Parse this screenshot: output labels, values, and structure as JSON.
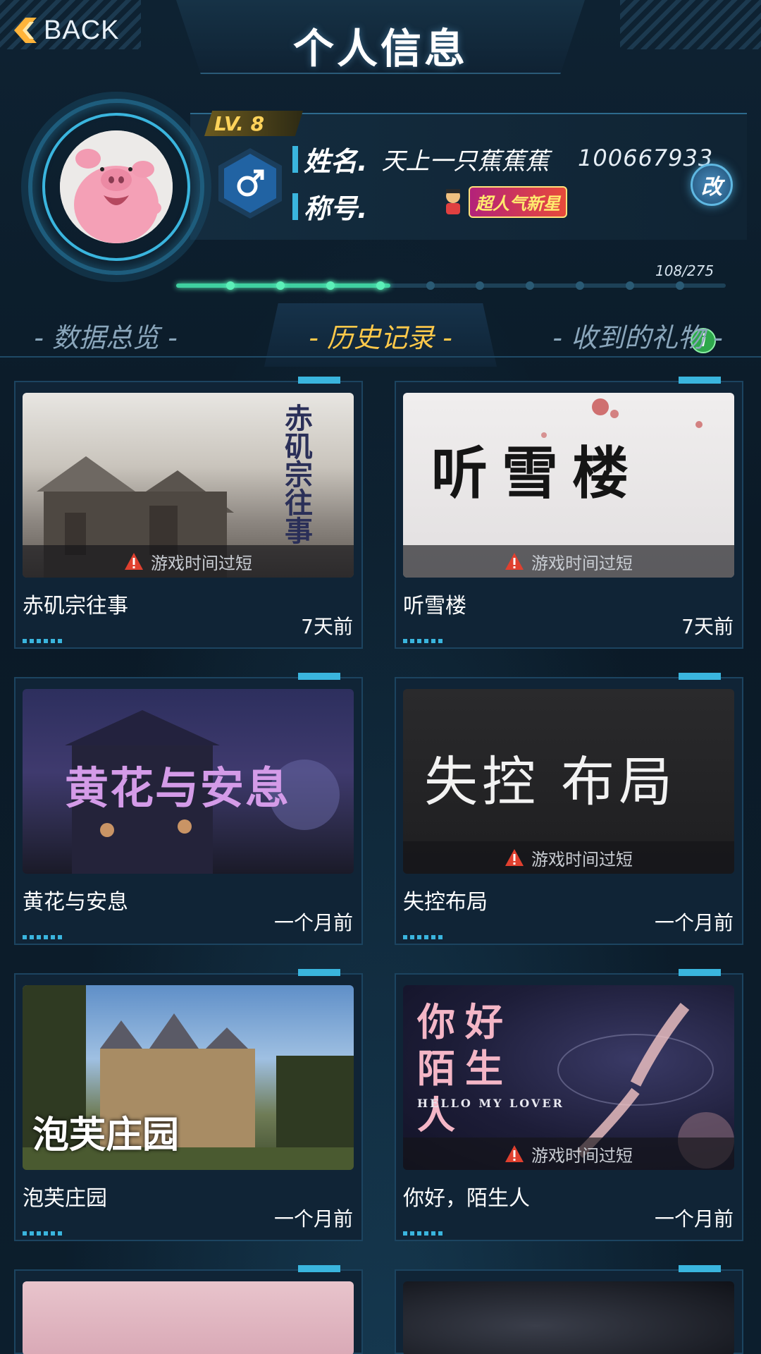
{
  "header": {
    "back_label": "BACK",
    "title": "个人信息"
  },
  "profile": {
    "level": "LV. 8",
    "gender_icon": "male-icon",
    "name_label": "姓名.",
    "name_value": "天上一只蕉蕉蕉",
    "uid": "100667933",
    "title_label": "称号.",
    "title_badge": "超人气新星",
    "xp_text": "108/275",
    "xp_progress": 0.39,
    "edit_label": "改",
    "info_label": "i"
  },
  "tabs": [
    {
      "label": "- 数据总览 -"
    },
    {
      "label": "- 历史记录 -"
    },
    {
      "label": "- 收到的礼物 -"
    }
  ],
  "history": {
    "warning_text": "游戏时间过短",
    "items": [
      {
        "name": "赤矶宗往事",
        "time": "7天前",
        "warning": true,
        "cover_title": "赤矶宗往事"
      },
      {
        "name": "听雪楼",
        "time": "7天前",
        "warning": true,
        "cover_title": "听雪楼"
      },
      {
        "name": "黄花与安息",
        "time": "一个月前",
        "warning": false,
        "cover_title": "黄花与安息"
      },
      {
        "name": "失控布局",
        "time": "一个月前",
        "warning": true,
        "cover_title": "失控 布局"
      },
      {
        "name": "泡芙庄园",
        "time": "一个月前",
        "warning": false,
        "cover_title": "泡芙庄园"
      },
      {
        "name": "你好，陌生人",
        "time": "一个月前",
        "warning": true,
        "cover_title": "你好 陌生人",
        "cover_subtitle": "HELLO MY LOVER"
      }
    ]
  },
  "colors": {
    "accent": "#3ab5de",
    "active_tab": "#ffc94a",
    "background": "#0c1b29"
  }
}
